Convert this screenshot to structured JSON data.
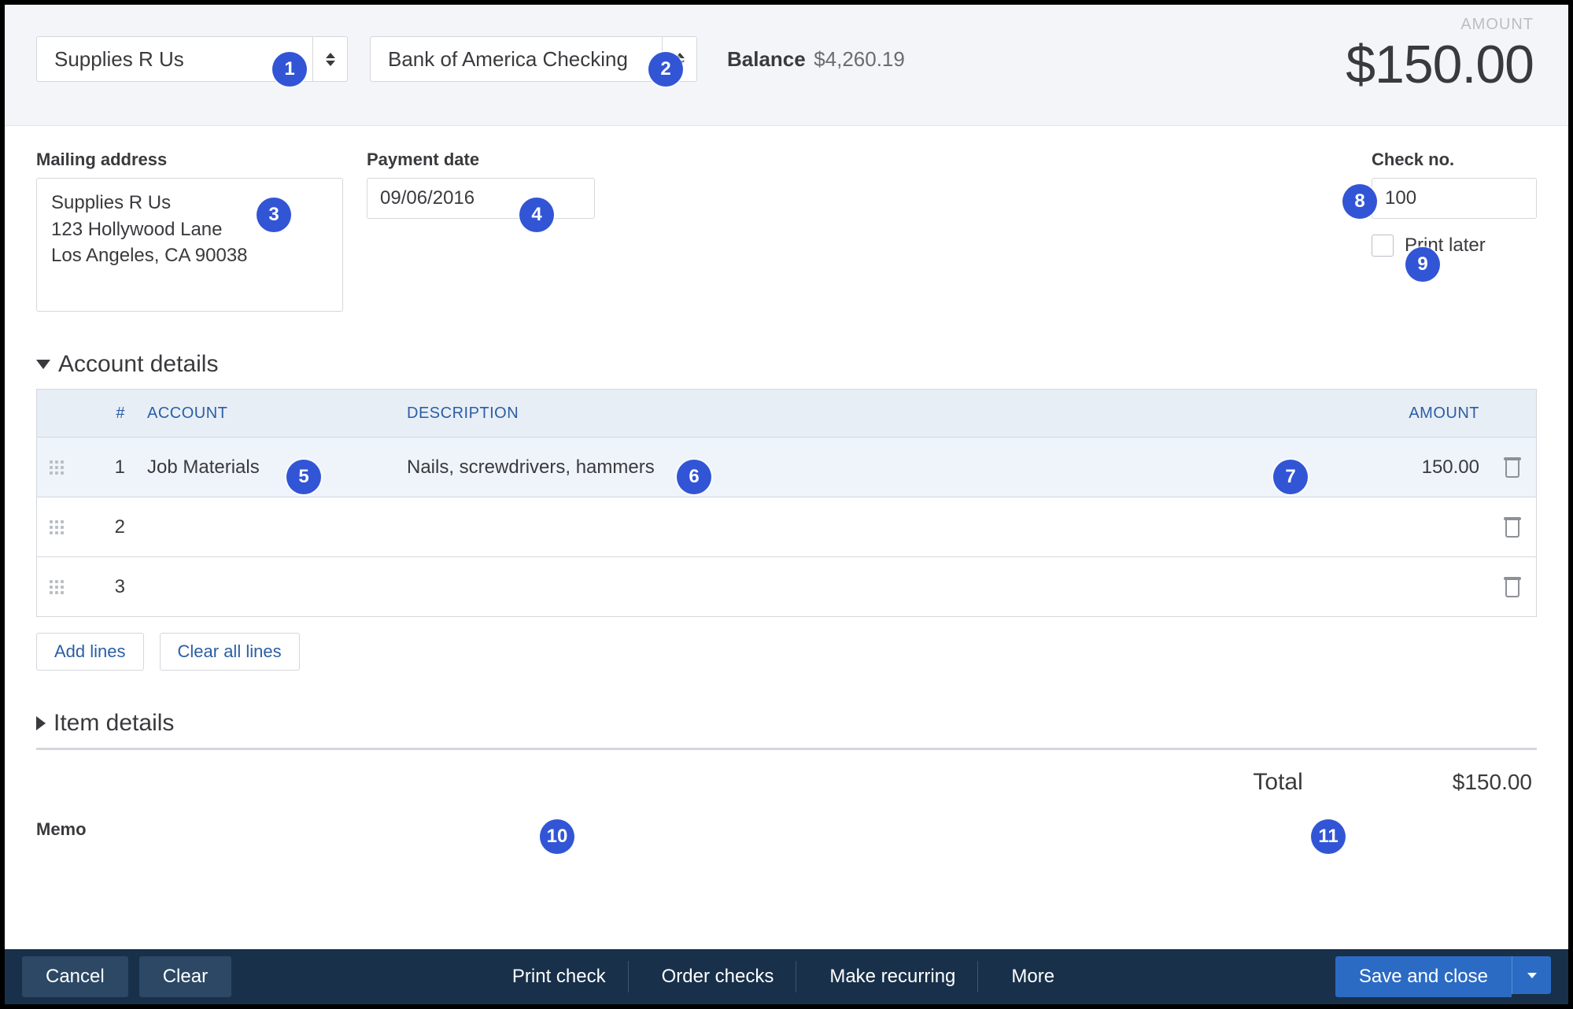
{
  "header": {
    "payee": "Supplies R Us",
    "account": "Bank of America Checking",
    "balance_label": "Balance",
    "balance_value": "$4,260.19",
    "amount_caption": "AMOUNT",
    "amount_value": "$150.00"
  },
  "fields": {
    "mailing_label": "Mailing address",
    "mailing_value": "Supplies R Us\n123 Hollywood Lane\nLos Angeles, CA  90038",
    "payment_date_label": "Payment date",
    "payment_date_value": "09/06/2016",
    "check_no_label": "Check no.",
    "check_no_value": "100",
    "print_later_label": "Print later"
  },
  "sections": {
    "account_details": "Account details",
    "item_details": "Item details"
  },
  "table": {
    "cols": {
      "num": "#",
      "account": "ACCOUNT",
      "description": "DESCRIPTION",
      "amount": "AMOUNT"
    },
    "rows": [
      {
        "num": "1",
        "account": "Job Materials",
        "description": "Nails, screwdrivers, hammers",
        "amount": "150.00"
      },
      {
        "num": "2",
        "account": "",
        "description": "",
        "amount": ""
      },
      {
        "num": "3",
        "account": "",
        "description": "",
        "amount": ""
      }
    ],
    "add_lines": "Add lines",
    "clear_all": "Clear all lines"
  },
  "total": {
    "label": "Total",
    "value": "$150.00"
  },
  "memo_label": "Memo",
  "footer": {
    "cancel": "Cancel",
    "clear": "Clear",
    "print_check": "Print check",
    "order_checks": "Order checks",
    "make_recurring": "Make recurring",
    "more": "More",
    "save": "Save and close"
  },
  "annotations": [
    "1",
    "2",
    "3",
    "4",
    "5",
    "6",
    "7",
    "8",
    "9",
    "10",
    "11"
  ]
}
